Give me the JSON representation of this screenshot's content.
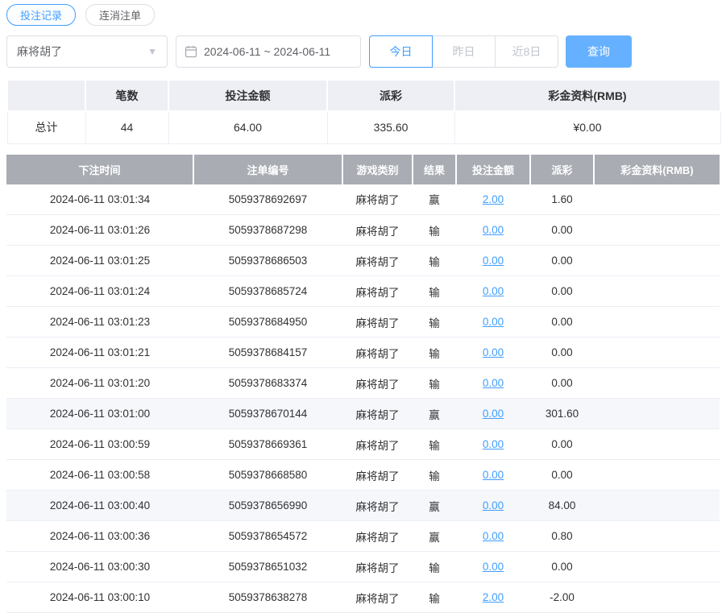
{
  "tabs": [
    {
      "label": "投注记录",
      "active": true
    },
    {
      "label": "连消注单",
      "active": false
    }
  ],
  "filters": {
    "game_select_value": "麻将胡了",
    "date_range": "2024-06-11 ~ 2024-06-11",
    "quick_buttons": [
      {
        "label": "今日",
        "active": true
      },
      {
        "label": "昨日",
        "active": false
      },
      {
        "label": "近8日",
        "active": false
      }
    ],
    "query_label": "查询"
  },
  "summary": {
    "headers": [
      "",
      "笔数",
      "投注金额",
      "派彩",
      "彩金资料(RMB)"
    ],
    "row_label": "总计",
    "count": "44",
    "bet_amount": "64.00",
    "payout": "335.60",
    "bonus": "¥0.00"
  },
  "table": {
    "headers": [
      "下注时间",
      "注单编号",
      "游戏类别",
      "结果",
      "投注金额",
      "派彩",
      "彩金资料(RMB)"
    ],
    "rows": [
      {
        "time": "2024-06-11 03:01:34",
        "order_id": "5059378692697",
        "game": "麻将胡了",
        "result": "赢",
        "bet": "2.00",
        "payout": "1.60",
        "bonus": "",
        "payout_negative": false,
        "highlight": false
      },
      {
        "time": "2024-06-11 03:01:26",
        "order_id": "5059378687298",
        "game": "麻将胡了",
        "result": "输",
        "bet": "0.00",
        "payout": "0.00",
        "bonus": "",
        "payout_negative": false,
        "highlight": false
      },
      {
        "time": "2024-06-11 03:01:25",
        "order_id": "5059378686503",
        "game": "麻将胡了",
        "result": "输",
        "bet": "0.00",
        "payout": "0.00",
        "bonus": "",
        "payout_negative": false,
        "highlight": false
      },
      {
        "time": "2024-06-11 03:01:24",
        "order_id": "5059378685724",
        "game": "麻将胡了",
        "result": "输",
        "bet": "0.00",
        "payout": "0.00",
        "bonus": "",
        "payout_negative": false,
        "highlight": false
      },
      {
        "time": "2024-06-11 03:01:23",
        "order_id": "5059378684950",
        "game": "麻将胡了",
        "result": "输",
        "bet": "0.00",
        "payout": "0.00",
        "bonus": "",
        "payout_negative": false,
        "highlight": false
      },
      {
        "time": "2024-06-11 03:01:21",
        "order_id": "5059378684157",
        "game": "麻将胡了",
        "result": "输",
        "bet": "0.00",
        "payout": "0.00",
        "bonus": "",
        "payout_negative": false,
        "highlight": false
      },
      {
        "time": "2024-06-11 03:01:20",
        "order_id": "5059378683374",
        "game": "麻将胡了",
        "result": "输",
        "bet": "0.00",
        "payout": "0.00",
        "bonus": "",
        "payout_negative": false,
        "highlight": false
      },
      {
        "time": "2024-06-11 03:01:00",
        "order_id": "5059378670144",
        "game": "麻将胡了",
        "result": "赢",
        "bet": "0.00",
        "payout": "301.60",
        "bonus": "",
        "payout_negative": false,
        "highlight": true
      },
      {
        "time": "2024-06-11 03:00:59",
        "order_id": "5059378669361",
        "game": "麻将胡了",
        "result": "输",
        "bet": "0.00",
        "payout": "0.00",
        "bonus": "",
        "payout_negative": false,
        "highlight": false
      },
      {
        "time": "2024-06-11 03:00:58",
        "order_id": "5059378668580",
        "game": "麻将胡了",
        "result": "输",
        "bet": "0.00",
        "payout": "0.00",
        "bonus": "",
        "payout_negative": false,
        "highlight": false
      },
      {
        "time": "2024-06-11 03:00:40",
        "order_id": "5059378656990",
        "game": "麻将胡了",
        "result": "赢",
        "bet": "0.00",
        "payout": "84.00",
        "bonus": "",
        "payout_negative": false,
        "highlight": true
      },
      {
        "time": "2024-06-11 03:00:36",
        "order_id": "5059378654572",
        "game": "麻将胡了",
        "result": "赢",
        "bet": "0.00",
        "payout": "0.80",
        "bonus": "",
        "payout_negative": false,
        "highlight": false
      },
      {
        "time": "2024-06-11 03:00:30",
        "order_id": "5059378651032",
        "game": "麻将胡了",
        "result": "输",
        "bet": "0.00",
        "payout": "0.00",
        "bonus": "",
        "payout_negative": false,
        "highlight": false
      },
      {
        "time": "2024-06-11 03:00:10",
        "order_id": "5059378638278",
        "game": "麻将胡了",
        "result": "输",
        "bet": "2.00",
        "payout": "-2.00",
        "bonus": "",
        "payout_negative": true,
        "highlight": false
      }
    ]
  },
  "colors": {
    "accent_blue": "#409eff",
    "query_button_blue": "#66b1ff",
    "table_header_gray": "#a9acb3",
    "negative_red": "#f56c6c"
  }
}
